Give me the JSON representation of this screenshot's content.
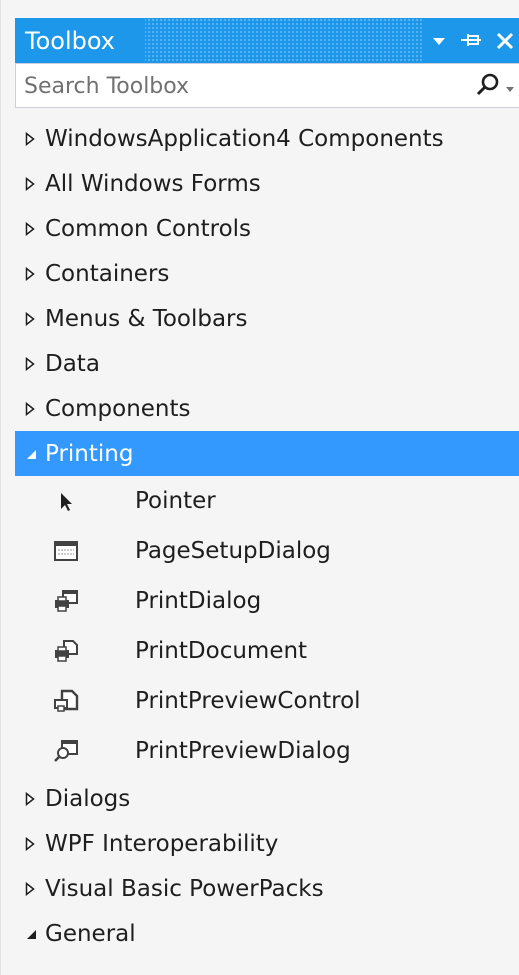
{
  "toolbox": {
    "title": "Toolbox",
    "search_placeholder": "Search Toolbox"
  },
  "colors": {
    "title_bar": "#1c97ea",
    "selection": "#3399ff",
    "panel_bg": "#f5f5f5",
    "text": "#1e1e1e"
  },
  "tree": {
    "groups_before": [
      {
        "label": "WindowsApplication4 Components",
        "expanded": false
      },
      {
        "label": "All Windows Forms",
        "expanded": false
      },
      {
        "label": "Common Controls",
        "expanded": false
      },
      {
        "label": "Containers",
        "expanded": false
      },
      {
        "label": "Menus & Toolbars",
        "expanded": false
      },
      {
        "label": "Data",
        "expanded": false
      },
      {
        "label": "Components",
        "expanded": false
      }
    ],
    "selected_group": {
      "label": "Printing",
      "expanded": true
    },
    "items": [
      {
        "label": "Pointer",
        "icon": "pointer-arrow-icon"
      },
      {
        "label": "PageSetupDialog",
        "icon": "page-setup-dialog-icon"
      },
      {
        "label": "PrintDialog",
        "icon": "print-dialog-icon"
      },
      {
        "label": "PrintDocument",
        "icon": "print-document-icon"
      },
      {
        "label": "PrintPreviewControl",
        "icon": "print-preview-control-icon"
      },
      {
        "label": "PrintPreviewDialog",
        "icon": "print-preview-dialog-icon"
      }
    ],
    "groups_after": [
      {
        "label": "Dialogs",
        "expanded": false
      },
      {
        "label": "WPF Interoperability",
        "expanded": false
      },
      {
        "label": "Visual Basic PowerPacks",
        "expanded": false
      },
      {
        "label": "General",
        "expanded": true
      }
    ]
  }
}
